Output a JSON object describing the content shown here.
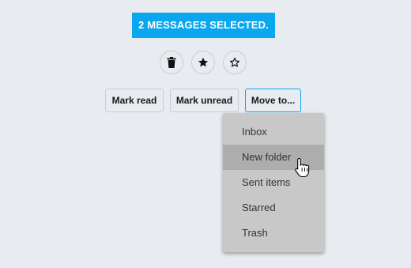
{
  "banner": {
    "text": "2 MESSAGES SELECTED."
  },
  "icons": [
    {
      "name": "trash-icon"
    },
    {
      "name": "star-filled-icon"
    },
    {
      "name": "star-outline-icon"
    }
  ],
  "actions": {
    "mark_read": "Mark read",
    "mark_unread": "Mark unread",
    "move_to": "Move to..."
  },
  "menu": {
    "items": [
      {
        "label": "Inbox"
      },
      {
        "label": "New folder"
      },
      {
        "label": "Sent items"
      },
      {
        "label": "Starred"
      },
      {
        "label": "Trash"
      }
    ],
    "hovered_item": "New folder"
  },
  "colors": {
    "accent": "#0aa7f0",
    "background": "#e8ebf0",
    "menu_bg": "#c8c8c8",
    "menu_hover": "#adadad"
  }
}
